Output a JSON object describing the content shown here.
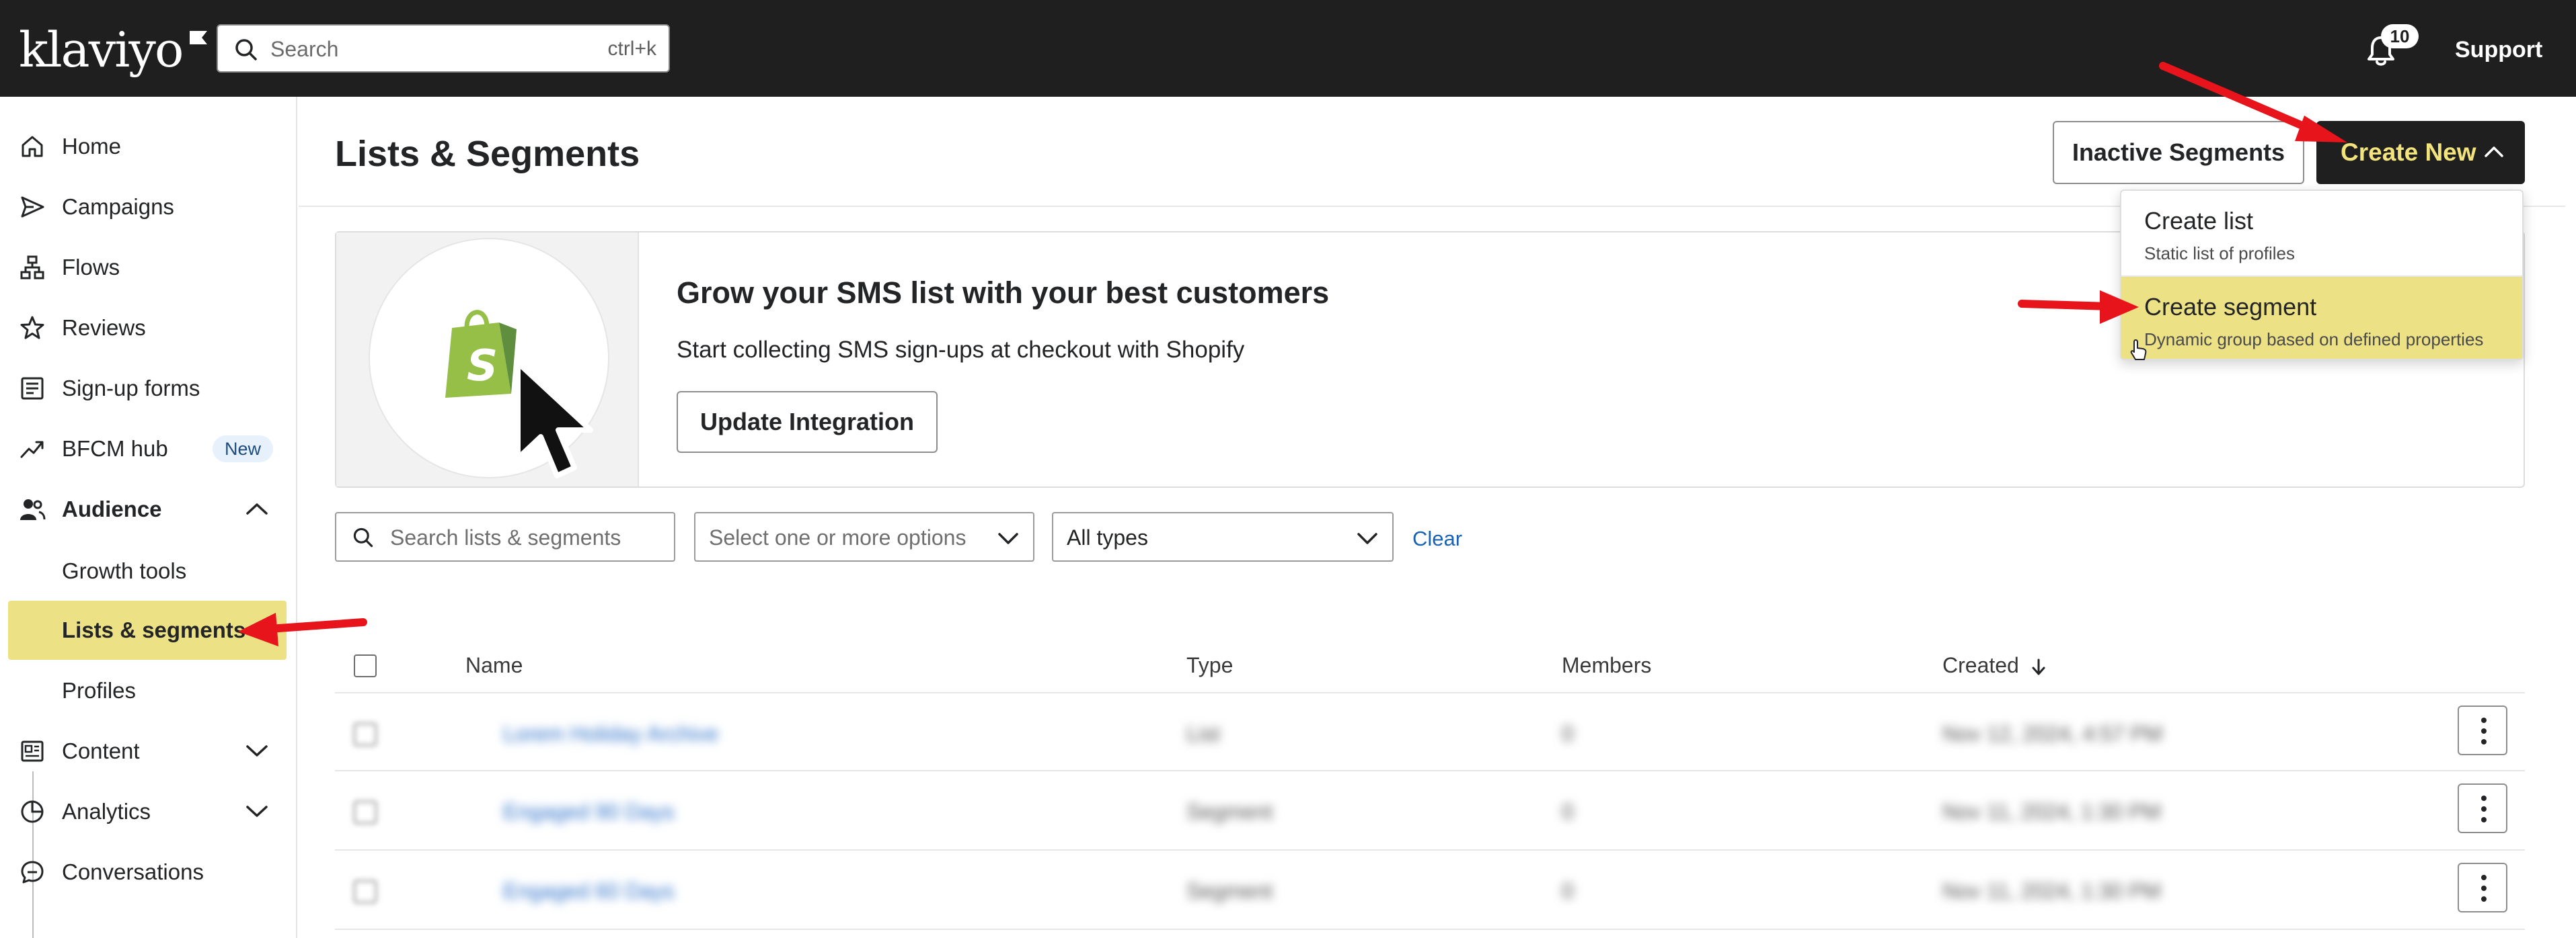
{
  "app": {
    "brand": "klaviyo"
  },
  "topbar": {
    "search_placeholder": "Search",
    "search_shortcut": "ctrl+k",
    "notifications_count": "10",
    "support_label": "Support"
  },
  "sidebar": {
    "items": [
      {
        "label": "Home",
        "icon": "home-icon"
      },
      {
        "label": "Campaigns",
        "icon": "send-icon"
      },
      {
        "label": "Flows",
        "icon": "flows-icon"
      },
      {
        "label": "Reviews",
        "icon": "star-icon"
      },
      {
        "label": "Sign-up forms",
        "icon": "form-icon"
      },
      {
        "label": "BFCM hub",
        "icon": "trend-icon",
        "badge": "New"
      },
      {
        "label": "Audience",
        "icon": "audience-icon",
        "expanded": true
      },
      {
        "label": "Content",
        "icon": "content-icon",
        "expanded": false
      },
      {
        "label": "Analytics",
        "icon": "analytics-icon",
        "expanded": false
      },
      {
        "label": "Conversations",
        "icon": "chat-icon"
      }
    ],
    "audience_children": [
      {
        "label": "Growth tools"
      },
      {
        "label": "Lists & segments",
        "active": true
      },
      {
        "label": "Profiles"
      }
    ]
  },
  "header": {
    "title": "Lists & Segments",
    "inactive_segments_label": "Inactive Segments",
    "create_new_label": "Create New"
  },
  "create_menu": {
    "items": [
      {
        "title": "Create list",
        "description": "Static list of profiles"
      },
      {
        "title": "Create segment",
        "description": "Dynamic group based on defined properties",
        "highlighted": true
      }
    ]
  },
  "promo": {
    "title": "Grow your SMS list with your best customers",
    "subtitle": "Start collecting SMS sign-ups at checkout with Shopify",
    "button_label": "Update Integration"
  },
  "filters": {
    "search_placeholder": "Search lists & segments",
    "tags_placeholder": "Select one or more options",
    "type_value": "All types",
    "clear_label": "Clear"
  },
  "table": {
    "columns": [
      "Name",
      "Type",
      "Members",
      "Created"
    ],
    "sort_column": "Created",
    "rows": [
      {
        "name": "Lorem Holiday Archive",
        "type": "List",
        "members": "0",
        "created": "Nov 12, 2024, 4:57 PM"
      },
      {
        "name": "Engaged 90 Days",
        "type": "Segment",
        "members": "0",
        "created": "Nov 11, 2024, 1:30 PM"
      },
      {
        "name": "Engaged 60 Days",
        "type": "Segment",
        "members": "0",
        "created": "Nov 11, 2024, 1:30 PM"
      }
    ]
  },
  "colors": {
    "topbar_bg": "#1f1f1f",
    "accent_yellow": "#f3e37c",
    "highlight_yellow": "#ece184",
    "link_blue": "#1b62b5",
    "annotation_red": "#e8141b"
  }
}
